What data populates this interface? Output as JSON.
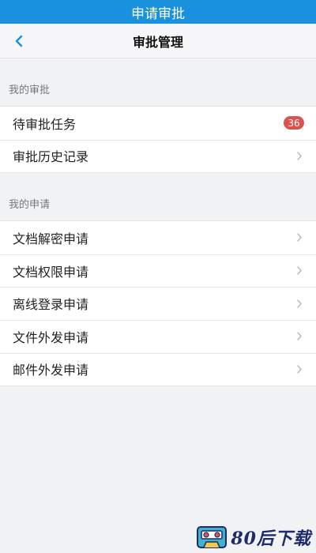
{
  "app": {
    "title": "申请审批"
  },
  "navbar": {
    "title": "审批管理",
    "back_icon": "chevron-left-icon"
  },
  "sections": [
    {
      "header": "我的审批",
      "items": [
        {
          "label": "待审批任务",
          "badge": "36"
        },
        {
          "label": "审批历史记录"
        }
      ]
    },
    {
      "header": "我的申请",
      "items": [
        {
          "label": "文档解密申请"
        },
        {
          "label": "文档权限申请"
        },
        {
          "label": "离线登录申请"
        },
        {
          "label": "文件外发申请"
        },
        {
          "label": "邮件外发申请"
        }
      ]
    }
  ],
  "watermark": {
    "text": "80后下载",
    "icon": "cassette-icon"
  },
  "colors": {
    "titlebar": "#1a91dc",
    "accent": "#1a91dc",
    "badge": "#d9534f",
    "background": "#f1f2f4"
  }
}
